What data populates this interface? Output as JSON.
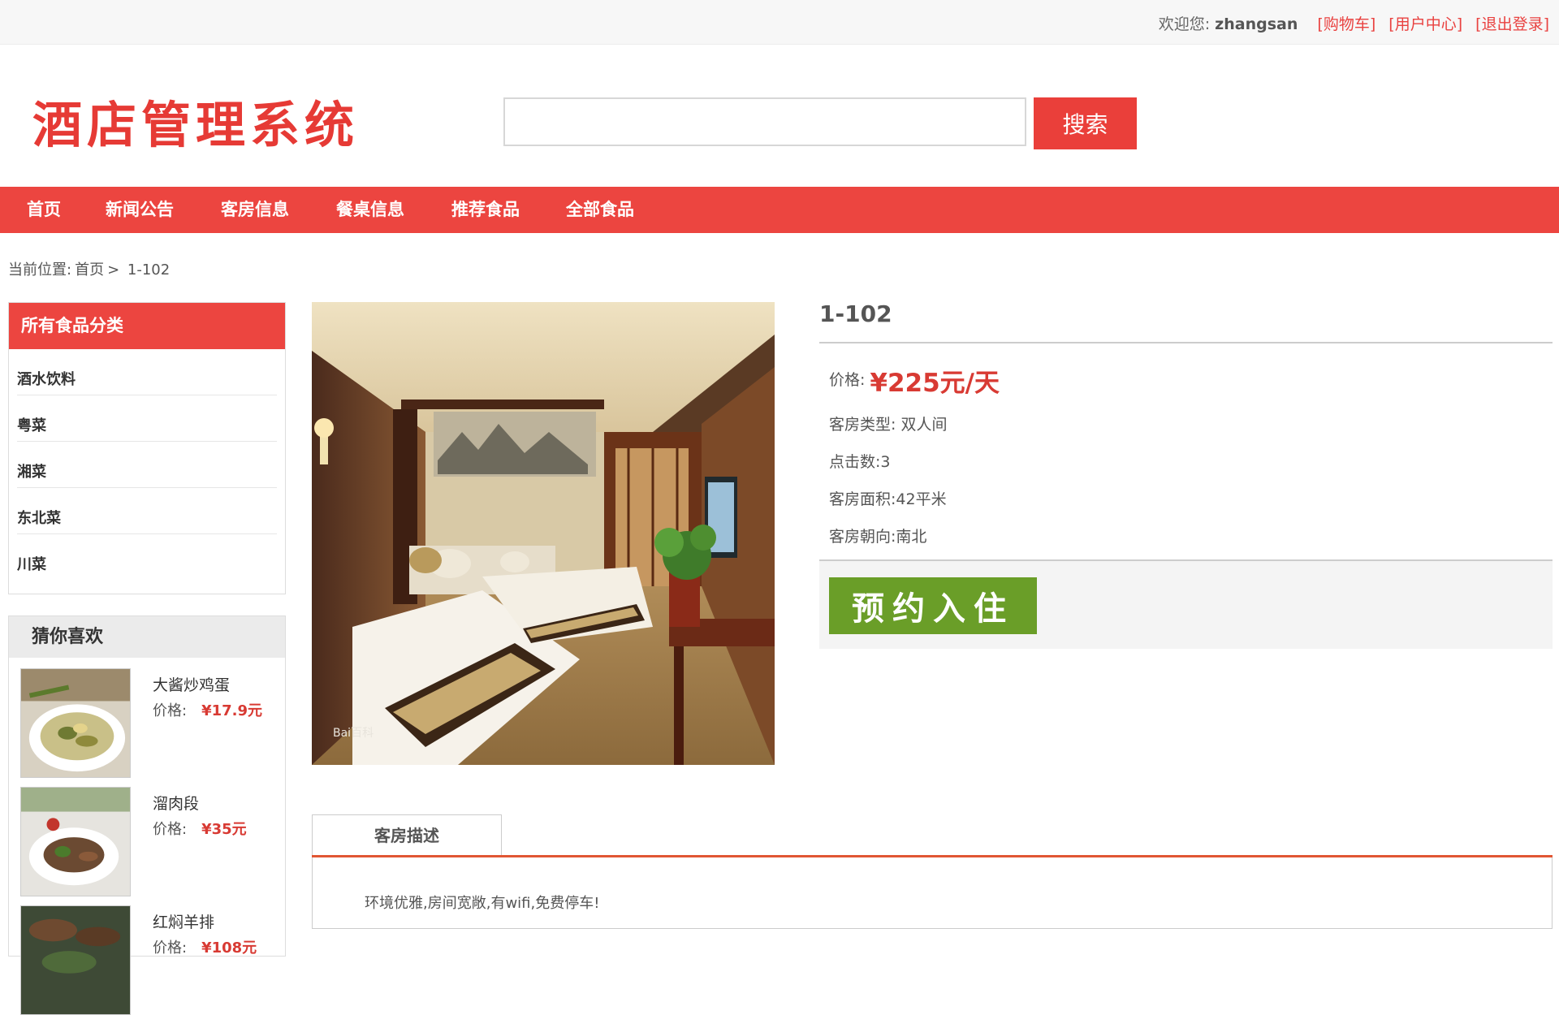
{
  "topbar": {
    "welcome": "欢迎您:",
    "username": "zhangsan",
    "cart": "[购物车]",
    "user_center": "[用户中心]",
    "logout": "[退出登录]"
  },
  "header": {
    "logo": "酒店管理系统",
    "search_value": "",
    "search_button": "搜索"
  },
  "nav": [
    "首页",
    "新闻公告",
    "客房信息",
    "餐桌信息",
    "推荐食品",
    "全部食品"
  ],
  "breadcrumb": {
    "prefix": "当前位置:",
    "home": "首页",
    "sep": ">",
    "current": "1-102"
  },
  "categories": {
    "title": "所有食品分类",
    "items": [
      "酒水饮料",
      "粤菜",
      "湘菜",
      "东北菜",
      "川菜"
    ]
  },
  "guess": {
    "title": "猜你喜欢",
    "price_label": "价格:",
    "items": [
      {
        "name": "大酱炒鸡蛋",
        "price": "¥17.9元"
      },
      {
        "name": "溜肉段",
        "price": "¥35元"
      },
      {
        "name": "红焖羊排",
        "price": "¥108元"
      }
    ]
  },
  "room": {
    "title": "1-102",
    "price_label": "价格:",
    "price": "¥225元/天",
    "type_label": "客房类型:",
    "type": "双人间",
    "clicks_label": "点击数:",
    "clicks": "3",
    "area_label": "客房面积:",
    "area": "42平米",
    "facing_label": "客房朝向:",
    "facing": "南北",
    "book_button": "预约入住",
    "photo_watermark": "Bai百科"
  },
  "description": {
    "tab": "客房描述",
    "text": "环境优雅,房间宽敞,有wifi,免费停车!"
  },
  "colors": {
    "brand_red": "#ec4540",
    "price_red": "#d83a33",
    "book_green": "#6a9e28",
    "link_red": "#e94240"
  }
}
